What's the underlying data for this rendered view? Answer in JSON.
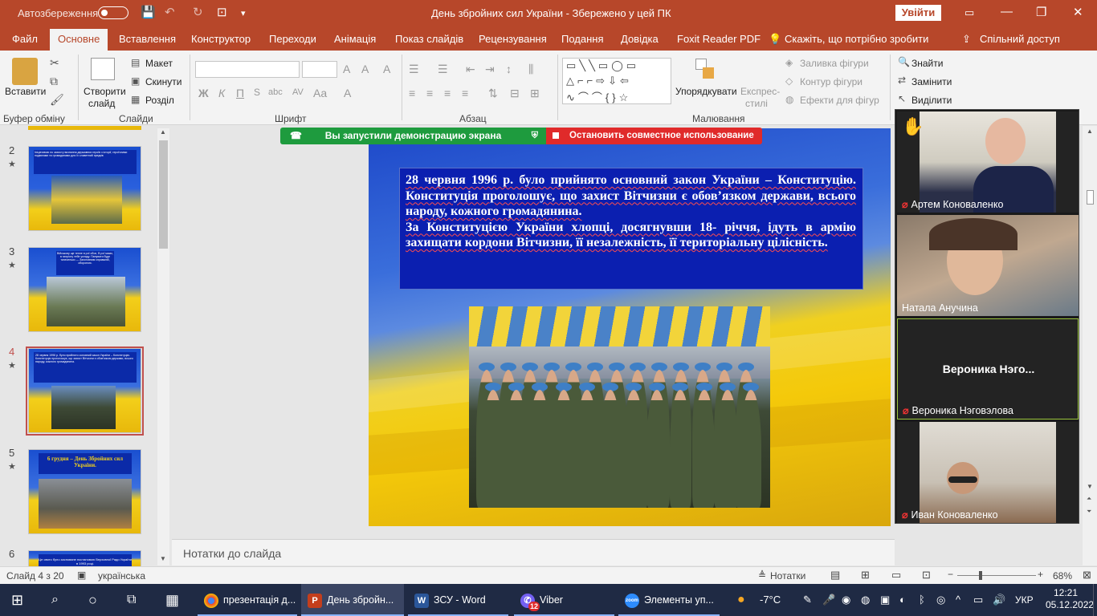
{
  "titlebar": {
    "autosave": "Автозбереження",
    "title": "День збройних сил України  -  Збережено у цей ПК",
    "signin": "Увійти"
  },
  "tabs": [
    "Файл",
    "Основне",
    "Вставлення",
    "Конструктор",
    "Переходи",
    "Анімація",
    "Показ слайдів",
    "Рецензування",
    "Подання",
    "Довідка",
    "Foxit Reader PDF"
  ],
  "tell_me": "Скажіть, що потрібно зробити",
  "share": "Спільний доступ",
  "ribbon": {
    "paste": "Вставити",
    "clipboard_group": "Буфер обміну",
    "new_slide_1": "Створити",
    "new_slide_2": "слайд",
    "layout": "Макет",
    "reset": "Скинути",
    "section": "Розділ",
    "slides_group": "Слайди",
    "font_group": "Шрифт",
    "paragraph_group": "Абзац",
    "arrange": "Упорядкувати",
    "quick_styles_1": "Експрес-",
    "quick_styles_2": "стилі",
    "shape_fill": "Заливка фігури",
    "shape_outline": "Контур фігури",
    "shape_effects": "Ефекти для фігур",
    "drawing_group": "Малювання",
    "find": "Знайти",
    "replace": "Замінити",
    "select": "Виділити",
    "editing_group": "Редагування"
  },
  "screen_share": {
    "status": "Вы запустили демонстрацию экрана",
    "stop": "Остановить совместное использование"
  },
  "thumbnails": [
    {
      "num": "2",
      "text": "Ініціативою по захисту визнання державних героїв з історії, героїчними подвигами та громадянами для їх славетний предків"
    },
    {
      "num": "3",
      "text": "Військову ще тепле в рої обоє, В рої мамо, в патріоту тебе укладу. Панувати буде тихесенько — Загоновним справжній, обороною."
    },
    {
      "num": "4",
      "text": "28 червня 1996 р. було прийнято основний закон України – Конституцію. Конституція проголошує, що захист Вітчизни є обов'язком держави, всього народу, кожного громадянина."
    },
    {
      "num": "5",
      "text": "6 грудня – День Збройних сил України."
    },
    {
      "num": "6",
      "text": "Це свято було засноване постановою Верховної Ради України в 1993 році."
    }
  ],
  "slide": {
    "paragraph1": "28 червня 1996 р. було прийнято основний закон України – Конституцію. Конституція проголошує, що захист Вітчизни є обов’язком держави, всього народу, кожного громадянина.",
    "paragraph2": "За Конституцією України хлопці, досягнувши 18- річчя, ідуть в армію захищати кордони Вітчизни, її незалежність, її територіальну цілісність."
  },
  "notes_placeholder": "Нотатки до слайда",
  "participants": [
    {
      "name": "Артем Коноваленко",
      "muted": true,
      "raised_hand": true
    },
    {
      "name": "Натала Анучина",
      "muted": false,
      "raised_hand": false
    },
    {
      "name": "Вероника Нэговэлова",
      "display": "Вероника  Нэго...",
      "muted": true,
      "raised_hand": false,
      "active": true
    },
    {
      "name": "Иван Коноваленко",
      "muted": true,
      "raised_hand": false
    }
  ],
  "status": {
    "slide": "Слайд 4 з 20",
    "language": "українська",
    "notes": "Нотатки",
    "zoom": "68%"
  },
  "taskbar": {
    "apps": [
      {
        "label": "презентація д...",
        "icon": "chrome-icon"
      },
      {
        "label": "День збройн...",
        "icon": "powerpoint-icon"
      },
      {
        "label": "ЗСУ - Word",
        "icon": "word-icon"
      },
      {
        "label": "Viber",
        "icon": "viber-icon",
        "badge": "12"
      },
      {
        "label": "Элементы уп...",
        "icon": "zoom-icon"
      }
    ],
    "weather": "-7°C",
    "lang": "УКР",
    "time": "12:21",
    "date": "05.12.2022"
  },
  "colors": {
    "accent": "#b7472a",
    "share_green": "#1e9b3e",
    "share_red": "#e02a2a",
    "slide_text_bg": "#0b1fb0"
  }
}
